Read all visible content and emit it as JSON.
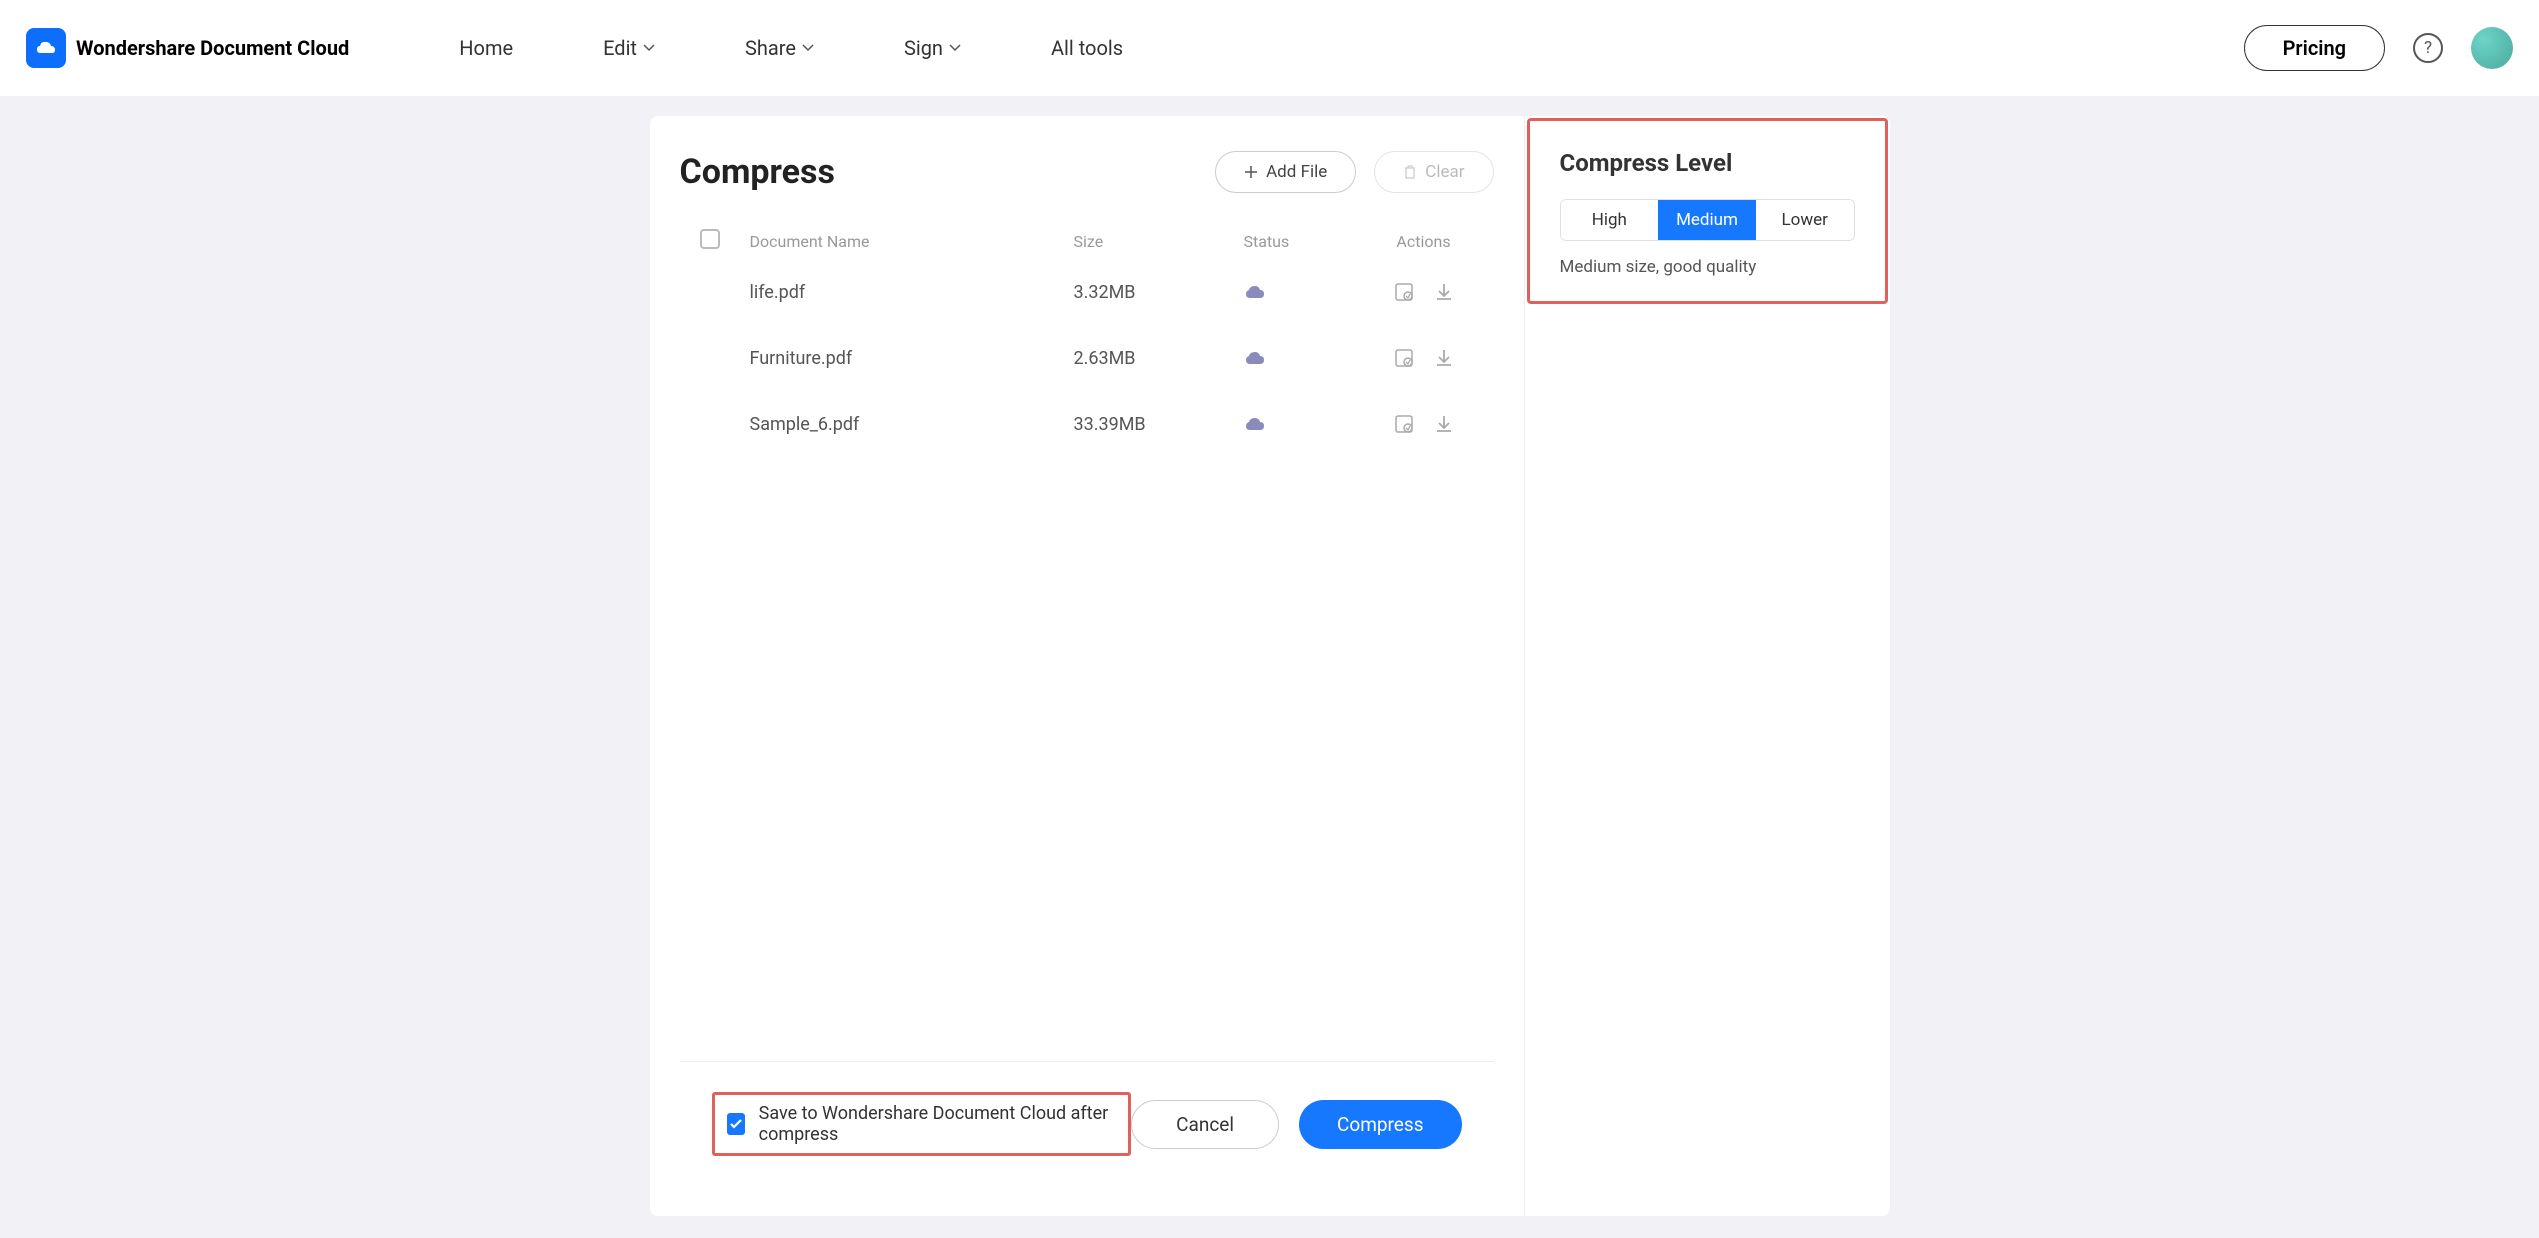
{
  "header": {
    "brand": "Wondershare Document Cloud",
    "nav": [
      "Home",
      "Edit",
      "Share",
      "Sign",
      "All tools"
    ],
    "pricing": "Pricing"
  },
  "page": {
    "title": "Compress",
    "addFile": "Add File",
    "clear": "Clear"
  },
  "table": {
    "headers": {
      "name": "Document Name",
      "size": "Size",
      "status": "Status",
      "actions": "Actions"
    },
    "rows": [
      {
        "name": "life.pdf",
        "size": "3.32MB"
      },
      {
        "name": "Furniture.pdf",
        "size": "2.63MB"
      },
      {
        "name": "Sample_6.pdf",
        "size": "33.39MB"
      }
    ]
  },
  "sidebar": {
    "title": "Compress Level",
    "levels": [
      "High",
      "Medium",
      "Lower"
    ],
    "desc": "Medium size, good quality"
  },
  "footer": {
    "saveLabel": "Save to Wondershare Document Cloud after compress",
    "cancel": "Cancel",
    "compress": "Compress"
  }
}
